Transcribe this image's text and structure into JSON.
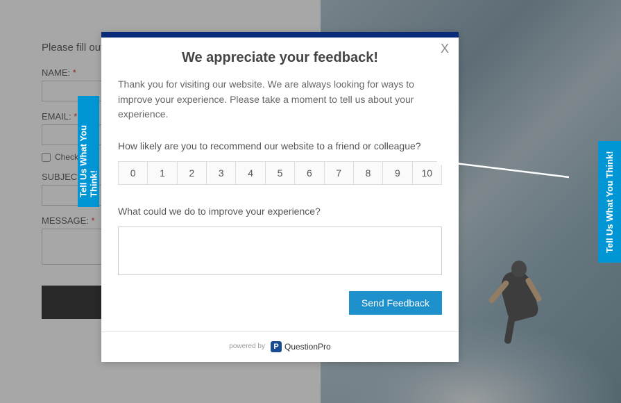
{
  "form": {
    "instruction": "Please fill out",
    "labels": {
      "name": "NAME:",
      "email": "EMAIL:",
      "checkbox": "Check",
      "subject": "SUBJECT:",
      "message": "MESSAGE:"
    },
    "required": "*"
  },
  "tabs": {
    "left": "Tell Us What You Think!",
    "right": "Tell Us What You Think!"
  },
  "modal": {
    "close": "X",
    "title": "We appreciate your feedback!",
    "intro": "Thank you for visiting our website. We are always looking for ways to improve your experience. Please take a moment to tell us about your experience.",
    "nps_question": "How likely are you to recommend our website to a friend or colleague?",
    "nps_values": [
      "0",
      "1",
      "2",
      "3",
      "4",
      "5",
      "6",
      "7",
      "8",
      "9",
      "10"
    ],
    "open_question": "What could we do to improve your experience?",
    "send_button": "Send Feedback",
    "powered_by": "powered by",
    "logo_letter": "P",
    "logo_text": "QuestionPro"
  }
}
